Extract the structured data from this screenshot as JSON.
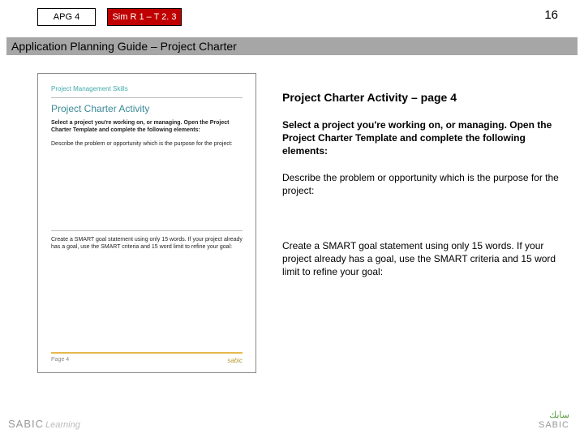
{
  "header": {
    "tag_apg": "APG 4",
    "tag_sim": "Sim R 1 – T 2. 3",
    "slide_number": "16"
  },
  "title_bar": "Application Planning Guide – Project Charter",
  "thumbnail": {
    "subject": "Project Management Skills",
    "heading": "Project Charter Activity",
    "bold": "Select a project you're working on, or managing. Open the Project Charter Template and complete the following elements:",
    "p1": "Describe the problem or opportunity which is the purpose for the project:",
    "p2": "Create a SMART goal statement using only 15 words. If your project already has a goal, use the SMART criteria and 15 word limit to refine your goal:",
    "page_label": "Page 4",
    "brand": "sabic"
  },
  "right": {
    "heading": "Project Charter Activity – page 4",
    "bold": "Select a project you're working on, or managing. Open the Project Charter Template and complete the following elements:",
    "p1": "Describe the problem or opportunity which is the purpose for the project:",
    "p2": "Create a SMART goal statement using only 15 words. If your project already has a goal, use the SMART criteria and 15 word limit to refine your goal:"
  },
  "footer": {
    "left_brand": "SABIC",
    "left_sub": "Learning",
    "right_ar": "سابك",
    "right_en": "SABIC"
  }
}
